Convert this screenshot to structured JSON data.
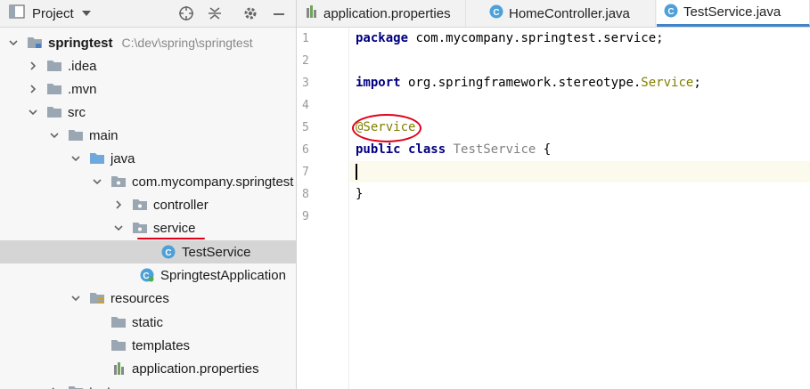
{
  "project": {
    "title": "Project",
    "tree": [
      {
        "label": "springtest",
        "path": "C:\\dev\\spring\\springtest"
      },
      {
        "label": ".idea"
      },
      {
        "label": ".mvn"
      },
      {
        "label": "src"
      },
      {
        "label": "main"
      },
      {
        "label": "java"
      },
      {
        "label": "com.mycompany.springtest"
      },
      {
        "label": "controller"
      },
      {
        "label": "service"
      },
      {
        "label": "TestService"
      },
      {
        "label": "SpringtestApplication"
      },
      {
        "label": "resources"
      },
      {
        "label": "static"
      },
      {
        "label": "templates"
      },
      {
        "label": "application.properties"
      },
      {
        "label": "test"
      }
    ]
  },
  "editor": {
    "tabs": [
      {
        "label": "application.properties"
      },
      {
        "label": "HomeController.java"
      },
      {
        "label": "TestService.java",
        "active": true
      }
    ],
    "line_numbers": [
      "1",
      "2",
      "3",
      "4",
      "5",
      "6",
      "7",
      "8",
      "9"
    ],
    "code": {
      "l1_kw": "package",
      "l1_rest": " com.mycompany.springtest.service;",
      "l3_kw": "import",
      "l3_rest": " org.springframework.stereotype.",
      "l3_cls": "Service",
      "l3_end": ";",
      "l5_ann": "@Service",
      "l6_kw": "public class",
      "l6_cls": " TestService",
      "l6_end": " {",
      "l8": "}"
    }
  },
  "colors": {
    "selection": "#d5d5d5",
    "active_tab": "#4083c9",
    "annotation_mark": "#e0001b",
    "keyword": "#000080",
    "annotation": "#808000"
  }
}
